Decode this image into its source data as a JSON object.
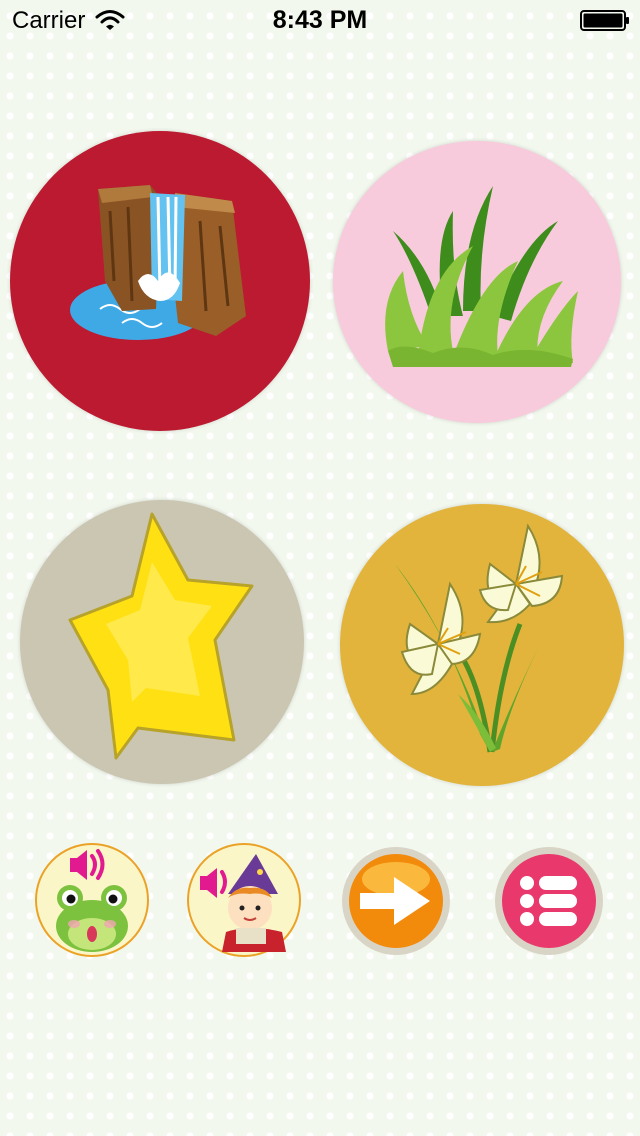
{
  "status_bar": {
    "carrier": "Carrier",
    "time": "8:43 PM",
    "wifi_icon": "wifi-icon",
    "battery_icon": "battery-icon"
  },
  "tiles": [
    {
      "name": "waterfall",
      "icon": "waterfall-icon",
      "bg": "#bb1a30"
    },
    {
      "name": "grass",
      "icon": "grass-icon",
      "bg": "#f7cbdc"
    },
    {
      "name": "star",
      "icon": "star-icon",
      "bg": "#cbc6b2"
    },
    {
      "name": "lily",
      "icon": "lily-flower-icon",
      "bg": "#e2b43c"
    }
  ],
  "toolbar": {
    "frog_sound": {
      "icon": "frog-speaker-icon",
      "accent": "#e21a8f"
    },
    "wizard_sound": {
      "icon": "wizard-speaker-icon",
      "accent": "#e21a8f"
    },
    "next": {
      "icon": "right-arrow-icon",
      "color": "#f28a0c"
    },
    "menu": {
      "icon": "list-menu-icon",
      "color": "#e9396c"
    }
  }
}
